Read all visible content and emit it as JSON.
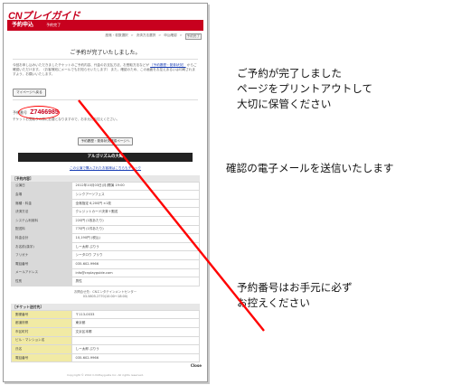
{
  "brand": {
    "logo_text": "CNプレイガイド",
    "accent": "#c8001e"
  },
  "header": {
    "title": "予約申込",
    "subtitle": "予約完了"
  },
  "steps": [
    "座席・枚数選択",
    "決済方法選択",
    "申込確認",
    "予約完了"
  ],
  "main": {
    "done_title": "ご予約が完了いたしました。",
    "intro_1": "今回お申し込みいただきましたチケットのご予約内容、代金のお支払方法、お受取方法などが",
    "intro_link": "［予約履歴・発券状況］",
    "intro_2": "からご確認いただけます。（お客様宛にメールでもお知らせいたします）",
    "intro_3": "また、確認のため、この画面をお控えあるいは印刷されますよう、お願いいたします。",
    "mypage_button": "マイページへ戻る",
    "reservation_label": "予約番号",
    "reservation_number": "Z7466985",
    "reservation_note": "チケットお受取りの際に必要となりますので、お手元にお控えください。",
    "history_button": "予約履歴・発券状況確認ページへ",
    "event_title": "アルゴリズムの大晦",
    "event_link": "この公演で購入されたお客様はこちらもチェック"
  },
  "booking": {
    "section_label": "［予約内容］",
    "rows": [
      {
        "key": "公演日",
        "value": "2012年10月03日(月)開演 19:00"
      },
      {
        "key": "会場",
        "value": "シンクアーツフェス"
      },
      {
        "key": "席種・料金",
        "value": "全席指定 6,200円 ×1枚"
      },
      {
        "key": "決済方法",
        "value": "クレジットカード決済＋郵送"
      },
      {
        "key": "システム利用料",
        "value": "220円 (1枚あたり)"
      },
      {
        "key": "配送料",
        "value": "770円 (1件あたり)"
      },
      {
        "key": "料金合計",
        "value": "10,190円 (税込)"
      },
      {
        "key": "お名前(漢字)",
        "value": "しー太郎 ぷりう"
      },
      {
        "key": "フリガナ",
        "value": "シータロウ プリウ"
      },
      {
        "key": "電話番号",
        "value": "035-602-9966"
      },
      {
        "key": "メールアドレス",
        "value": "info@cnplayguide.com"
      },
      {
        "key": "性別",
        "value": "男性"
      }
    ],
    "contact_1": "お問合せ先：CNエンタテインメントセンター",
    "contact_2": "03-5805-2770(10:00〜18:00)"
  },
  "delivery": {
    "section_label": "［チケット送付先］",
    "rows": [
      {
        "key": "郵便番号",
        "value": "〒113-0033"
      },
      {
        "key": "都道府県",
        "value": "東京都"
      },
      {
        "key": "市区町村",
        "value": "文京区本郷"
      },
      {
        "key": "ビル・マンション名",
        "value": ""
      },
      {
        "key": "氏名",
        "value": "しー太郎 ぷりう"
      },
      {
        "key": "電話番号",
        "value": "035-602-9966"
      }
    ]
  },
  "footer": {
    "close_label": "Close",
    "copyright": "Copyright © 2012 C.N.Playguide Inc. All rights reserved."
  },
  "annotations": {
    "line1": "ご予約が完了しました",
    "line2": "ページをプリントアウトして",
    "line3": "大切に保管ください",
    "line4": "確認の電子メールを送信いたします",
    "line5": "予約番号はお手元に必ず",
    "line6": "お控えください",
    "arrow_color": "#ff0000"
  }
}
